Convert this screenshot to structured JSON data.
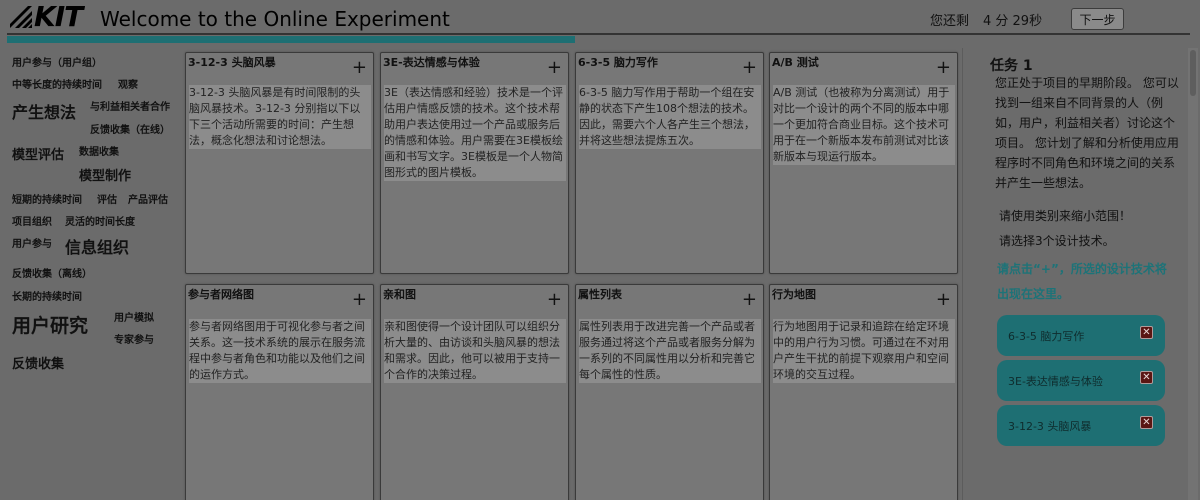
{
  "header": {
    "logo_text": "KIT",
    "title": "Welcome to the Online Experiment",
    "timer_label": "您还剩",
    "timer_value": "4 分 29秒",
    "next_label": "下一步",
    "accent_color": "#1e6f73",
    "progress_fraction": 0.48
  },
  "tags": [
    {
      "label": "用户参与（用户组）",
      "size": 1
    },
    {
      "label": "中等长度的持续时间",
      "size": 1
    },
    {
      "label": "观察",
      "size": 1
    },
    {
      "label": "产生想法",
      "size": 3
    },
    {
      "label": "与利益相关者合作",
      "size": 1
    },
    {
      "label": "反馈收集（在线）",
      "size": 1
    },
    {
      "label": "模型评估",
      "size": 2
    },
    {
      "label": "数据收集",
      "size": 1
    },
    {
      "label": "模型制作",
      "size": 2
    },
    {
      "label": "短期的持续时间",
      "size": 1
    },
    {
      "label": "评估",
      "size": 1
    },
    {
      "label": "产品评估",
      "size": 1
    },
    {
      "label": "项目组织",
      "size": 1
    },
    {
      "label": "灵活的时间长度",
      "size": 1
    },
    {
      "label": "用户参与",
      "size": 1
    },
    {
      "label": "信息组织",
      "size": 3
    },
    {
      "label": "反馈收集（离线）",
      "size": 1
    },
    {
      "label": "长期的持续时间",
      "size": 1
    },
    {
      "label": "用户研究",
      "size": 4
    },
    {
      "label": "用户模拟",
      "size": 1
    },
    {
      "label": "专家参与",
      "size": 1
    },
    {
      "label": "反馈收集",
      "size": 2
    }
  ],
  "cards": [
    {
      "title": "3-12-3 头脑风暴",
      "add": "+",
      "desc": "3-12-3 头脑风暴是有时间限制的头脑风暴技术。3-12-3 分别指以下以下三个活动所需要的时间：产生想法，概念化想法和讨论想法。"
    },
    {
      "title": "3E-表达情感与体验",
      "add": "+",
      "desc": "3E（表达情感和经验）技术是一个评估用户情感反馈的技术。这个技术帮助用户表达使用过一个产品或服务后的情感和体验。用户需要在3E模板绘画和书写文字。3E模板是一个人物简图形式的图片模板。"
    },
    {
      "title": "6-3-5 脑力写作",
      "add": "+",
      "desc": "6-3-5 脑力写作用于帮助一个组在安静的状态下产生108个想法的技术。因此，需要六个人各产生三个想法，并将这些想法提炼五次。"
    },
    {
      "title": "A/B 测试",
      "add": "+",
      "desc": "A/B 测试（也被称为分离测试）用于对比一个设计的两个不同的版本中哪一个更加符合商业目标。这个技术可用于在一个新版本发布前测试对比该新版本与现运行版本。"
    },
    {
      "title": "参与者网络图",
      "add": "+",
      "desc": "参与者网络图用于可视化参与者之间关系。这一技术系统的展示在服务流程中参与者角色和功能以及他们之间的运作方式。"
    },
    {
      "title": "亲和图",
      "add": "+",
      "desc": "亲和图使得一个设计团队可以组织分析大量的、由访谈和头脑风暴的想法和需求。因此，他可以被用于支持一个合作的决策过程。"
    },
    {
      "title": "属性列表",
      "add": "+",
      "desc": "属性列表用于改进完善一个产品或者服务通过将这个产品或者服务分解为一系列的不同属性用以分析和完善它每个属性的性质。"
    },
    {
      "title": "行为地图",
      "add": "+",
      "desc": "行为地图用于记录和追踪在给定环境中的用户行为习惯。可通过在不对用户产生干扰的前提下观察用户和空间环境的交互过程。"
    }
  ],
  "task": {
    "title": "任务 1",
    "body": "您正处于项目的早期阶段。 您可以找到一组来自不同背景的人（例如，用户，利益相关者）讨论这个项目。 您计划了解和分析使用应用程序时不同角色和环境之间的关系并产生一些想法。",
    "narrow": "请使用类别来缩小范围！",
    "choose": "请选择3个设计技术。",
    "hint": "请点击“+”，所选的设计技术将出现在这里。",
    "selected": [
      {
        "label": "6-3-5 脑力写作",
        "remove": "✕"
      },
      {
        "label": "3E-表达情感与体验",
        "remove": "✕"
      },
      {
        "label": "3-12-3 头脑风暴",
        "remove": "✕"
      }
    ]
  }
}
